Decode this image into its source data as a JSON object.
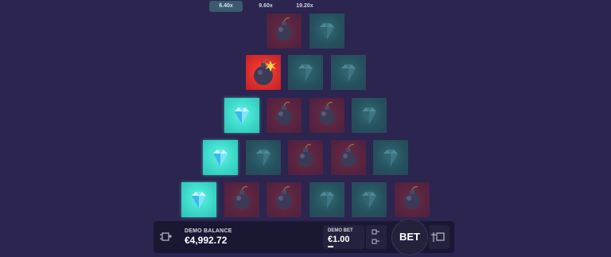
{
  "multipliers": [
    "6.40x",
    "9.60x",
    "19.20x"
  ],
  "active_multiplier_index": 0,
  "rows": [
    [
      "bomb",
      "gem"
    ],
    [
      "exploded",
      "gem",
      "gem"
    ],
    [
      "revealed-gem",
      "bomb",
      "bomb",
      "gem"
    ],
    [
      "revealed-gem",
      "gem",
      "bomb",
      "bomb",
      "gem"
    ],
    [
      "revealed-gem",
      "bomb",
      "bomb",
      "gem",
      "gem",
      "bomb"
    ]
  ],
  "footer": {
    "balance_label": "DEMO BALANCE",
    "balance_value": "€4,992.72",
    "bet_label": "DEMO BET",
    "bet_value": "€1.00",
    "bet_button_label": "BET"
  },
  "colors": {
    "background": "#2b2550",
    "gem_revealed": "#3ad7c8",
    "bomb_exploded": "#e5322b"
  }
}
